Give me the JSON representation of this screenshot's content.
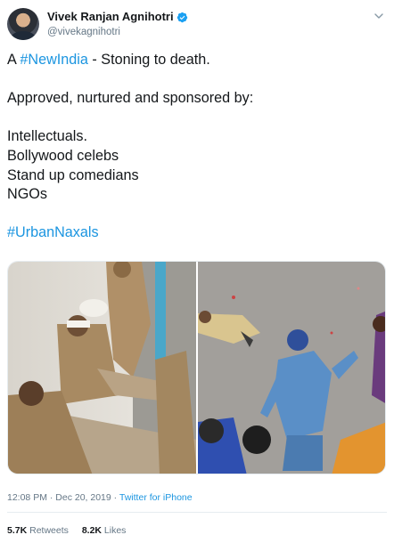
{
  "author": {
    "display_name": "Vivek Ranjan Agnihotri",
    "handle": "@vivekagnihotri",
    "verified_color": "#1da1f2"
  },
  "tweet": {
    "line1_prefix": "A ",
    "line1_hashtag": "#NewIndia",
    "line1_suffix": " - Stoning to death.",
    "line2": "Approved, nurtured and sponsored by:",
    "list": [
      "Intellectuals.",
      "Bollywood celebs",
      "Stand up comedians",
      "NGOs"
    ],
    "hashtag_footer": "#UrbanNaxals"
  },
  "meta": {
    "time_date": "12:08 PM · Dec 20, 2019 · ",
    "source": "Twitter for iPhone"
  },
  "stats": {
    "retweets_count": "5.7K",
    "retweets_label": "Retweets",
    "likes_count": "8.2K",
    "likes_label": "Likes"
  },
  "colors": {
    "link": "#1b95e0",
    "text": "#14171a",
    "muted": "#657786"
  },
  "icons": [
    "verified-badge-icon",
    "chevron-down-icon"
  ]
}
